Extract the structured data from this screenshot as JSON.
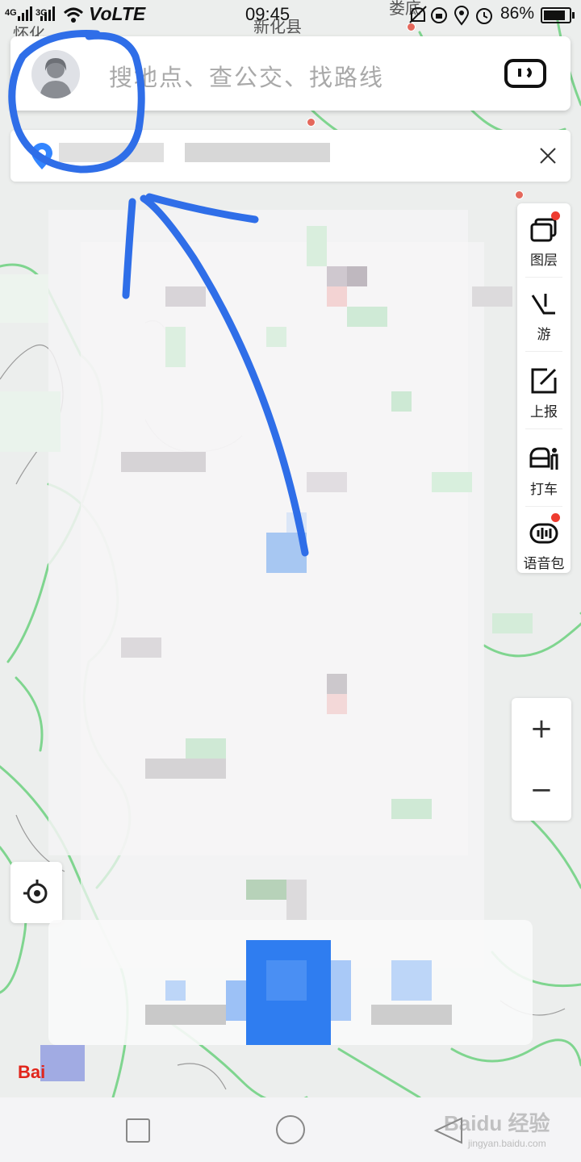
{
  "status_bar": {
    "network_1": "4G",
    "network_2": "3G",
    "volte": "VoLTE",
    "time": "09:45",
    "battery": "86%"
  },
  "map": {
    "labels": {
      "county": "新化县",
      "city_top": "娄底",
      "city_left": "怀化"
    }
  },
  "search": {
    "placeholder": "搜地点、查公交、找路线",
    "avatar_icon": "user-avatar-icon",
    "scan_icon": "scan-icon"
  },
  "location_bar": {
    "close_icon": "close-icon"
  },
  "toolbar": {
    "items": [
      {
        "label": "图层",
        "icon": "layers-icon",
        "badge": true
      },
      {
        "label": "游",
        "icon": "tour-icon",
        "badge": false
      },
      {
        "label": "上报",
        "icon": "report-icon",
        "badge": false
      },
      {
        "label": "打车",
        "icon": "taxi-icon",
        "badge": false
      },
      {
        "label": "语音包",
        "icon": "voice-pack-icon",
        "badge": true
      }
    ]
  },
  "zoom": {
    "in": "+",
    "out": "−"
  },
  "brand": {
    "logo": "Bai"
  },
  "watermark": {
    "main": "Baidu 经验",
    "sub": "jingyan.baidu.com"
  },
  "colors": {
    "annotation": "#2f6ee8",
    "badge": "#ee3b2f",
    "accent_blue": "#3385ff"
  }
}
